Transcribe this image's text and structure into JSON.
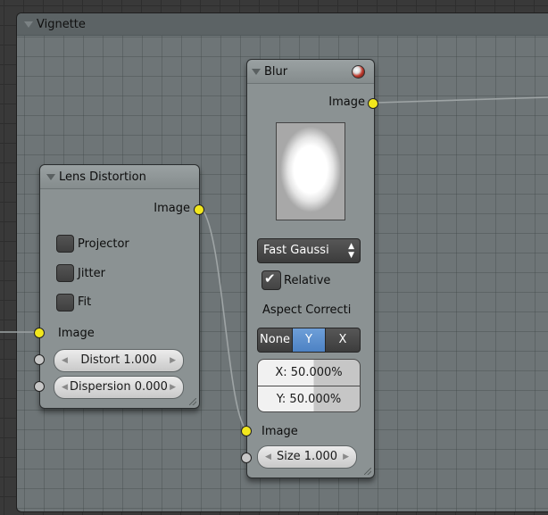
{
  "frame": {
    "title": "Vignette"
  },
  "lens_distortion": {
    "title": "Lens Distortion",
    "output_label": "Image",
    "options": [
      {
        "label": "Projector",
        "checked": false
      },
      {
        "label": "Jitter",
        "checked": false
      },
      {
        "label": "Fit",
        "checked": false
      }
    ],
    "input_label": "Image",
    "distort_label": "Distort 1.000",
    "dispersion_label": "Dispersion 0.000"
  },
  "blur": {
    "title": "Blur",
    "output_label": "Image",
    "filter_type": "Fast Gaussi",
    "relative_label": "Relative",
    "relative_checked": true,
    "aspect_label": "Aspect Correcti",
    "aspect_options": [
      "None",
      "Y",
      "X"
    ],
    "aspect_selected": "Y",
    "x_value": "X: 50.000%",
    "y_value": "Y: 50.000%",
    "input_label": "Image",
    "size_label": "Size 1.000"
  },
  "colors": {
    "socket_image": "#f2e71c",
    "socket_value": "#c7c7c7",
    "selected_segment": "#5b8fd0"
  }
}
